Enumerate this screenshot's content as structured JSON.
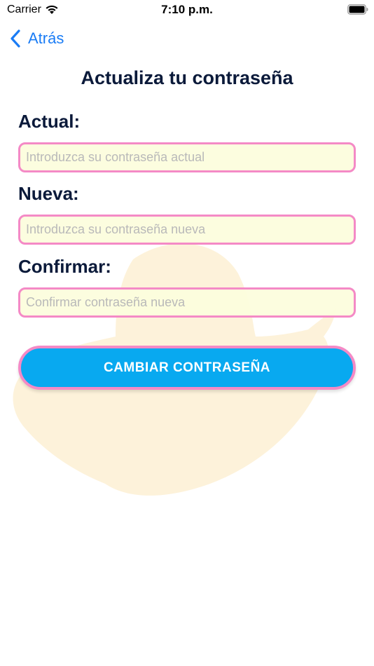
{
  "status_bar": {
    "carrier": "Carrier",
    "time": "7:10 p.m."
  },
  "nav": {
    "back_label": "Atrás",
    "accent_color": "#1a7cf5"
  },
  "page": {
    "title": "Actualiza tu contraseña"
  },
  "form": {
    "current": {
      "label": "Actual:",
      "placeholder": "Introduzca su contraseña actual",
      "value": ""
    },
    "new": {
      "label": "Nueva:",
      "placeholder": "Introduzca su contraseña nueva",
      "value": ""
    },
    "confirm": {
      "label": "Confirmar:",
      "placeholder": "Confirmar contraseña nueva",
      "value": ""
    },
    "submit_label": "CAMBIAR CONTRASEÑA"
  },
  "colors": {
    "title": "#0b1a3a",
    "input_border": "#f48ac6",
    "input_background": "#fcfddd",
    "button_background": "#08a9f0",
    "watermark": "#fdf1d8"
  },
  "icons": {
    "wifi": "wifi-icon",
    "battery": "battery-icon",
    "back": "chevron-left-icon",
    "watermark": "hat-watermark-icon"
  }
}
